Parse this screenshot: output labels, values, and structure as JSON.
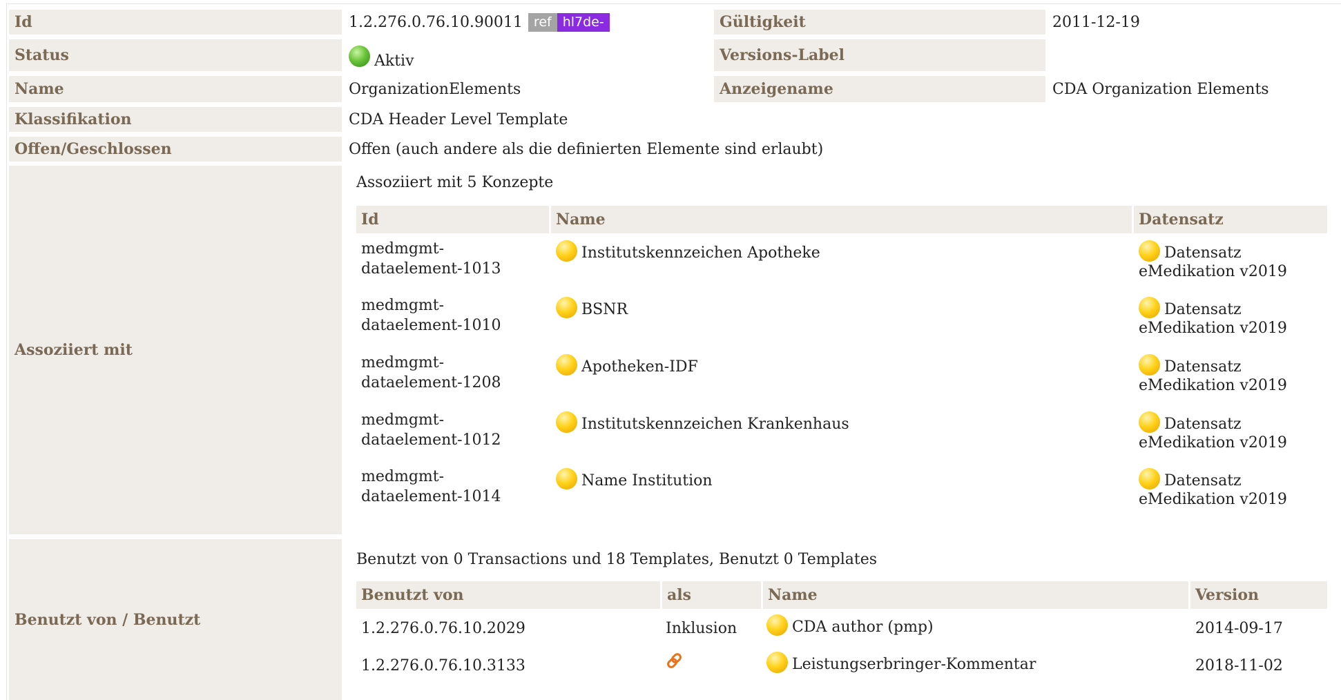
{
  "fields": {
    "id_label": "Id",
    "id_value": "1.2.276.0.76.10.90011",
    "id_tag_ref": "ref",
    "id_tag_prefix": "hl7de-",
    "validity_label": "Gültigkeit",
    "validity_value": "2011-12-19",
    "status_label": "Status",
    "status_value": "Aktiv",
    "status_color": "#5cb82e",
    "version_label_label": "Versions-Label",
    "version_label_value": "",
    "name_label": "Name",
    "name_value": "OrganizationElements",
    "display_name_label": "Anzeigename",
    "display_name_value": "CDA Organization Elements",
    "classification_label": "Klassifikation",
    "classification_value": "CDA Header Level Template",
    "open_closed_label": "Offen/Geschlossen",
    "open_closed_value": "Offen (auch andere als die definierten Elemente sind erlaubt)"
  },
  "associated": {
    "label": "Assoziiert mit",
    "caption": "Assoziiert mit 5 Konzepte",
    "headers": [
      "Id",
      "Name",
      "Datensatz"
    ],
    "rows": [
      {
        "id_line1": "medmgmt-",
        "id_line2": "dataelement-1013",
        "name": "Institutskennzeichen Apotheke",
        "ds_line1": "Datensatz",
        "ds_line2": "eMedikation v2019"
      },
      {
        "id_line1": "medmgmt-",
        "id_line2": "dataelement-1010",
        "name": "BSNR",
        "ds_line1": "Datensatz",
        "ds_line2": "eMedikation v2019"
      },
      {
        "id_line1": "medmgmt-",
        "id_line2": "dataelement-1208",
        "name": "Apotheken-IDF",
        "ds_line1": "Datensatz",
        "ds_line2": "eMedikation v2019"
      },
      {
        "id_line1": "medmgmt-",
        "id_line2": "dataelement-1012",
        "name": "Institutskennzeichen Krankenhaus",
        "ds_line1": "Datensatz",
        "ds_line2": "eMedikation v2019"
      },
      {
        "id_line1": "medmgmt-",
        "id_line2": "dataelement-1014",
        "name": "Name Institution",
        "ds_line1": "Datensatz",
        "ds_line2": "eMedikation v2019"
      }
    ],
    "status_color": "#ffc400"
  },
  "used_by": {
    "label": "Benutzt von / Benutzt",
    "caption": "Benutzt von 0 Transactions und 18 Templates, Benutzt 0 Templates",
    "headers": [
      "Benutzt von",
      "als",
      "Name",
      "Version"
    ],
    "rows": [
      {
        "oid": "1.2.276.0.76.10.2029",
        "as": "Inklusion",
        "as_icon": "",
        "name": "CDA author (pmp)",
        "version": "2014-09-17"
      },
      {
        "oid": "1.2.276.0.76.10.3133",
        "as": "",
        "as_icon": "link-icon",
        "name": "Leistungserbringer-Kommentar",
        "version": "2018-11-02"
      }
    ]
  }
}
